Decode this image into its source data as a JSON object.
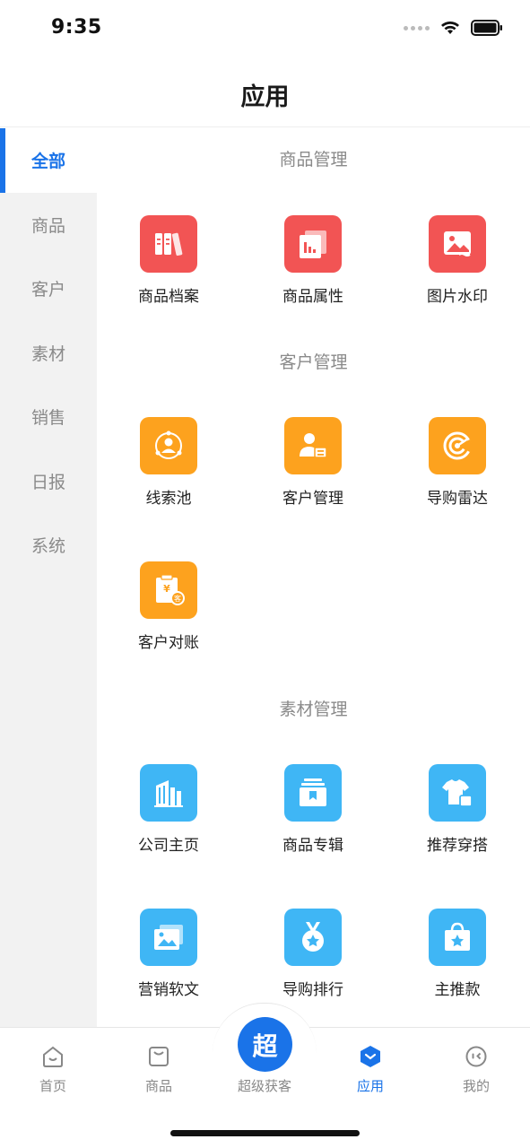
{
  "status": {
    "time": "9:35"
  },
  "header": {
    "title": "应用"
  },
  "sidebar": {
    "items": [
      {
        "label": "全部"
      },
      {
        "label": "商品"
      },
      {
        "label": "客户"
      },
      {
        "label": "素材"
      },
      {
        "label": "销售"
      },
      {
        "label": "日报"
      },
      {
        "label": "系统"
      }
    ],
    "active_index": 0
  },
  "sections": [
    {
      "title": "商品管理",
      "color": "#f25454",
      "tiles": [
        {
          "label": "商品档案",
          "icon": "books-icon"
        },
        {
          "label": "商品属性",
          "icon": "bar-chart-document-icon"
        },
        {
          "label": "图片水印",
          "icon": "image-watermark-icon"
        }
      ]
    },
    {
      "title": "客户管理",
      "color": "#fda21e",
      "tiles": [
        {
          "label": "线索池",
          "icon": "person-network-icon"
        },
        {
          "label": "客户管理",
          "icon": "contact-card-icon"
        },
        {
          "label": "导购雷达",
          "icon": "radar-icon"
        },
        {
          "label": "客户对账",
          "icon": "yuan-clipboard-icon"
        }
      ]
    },
    {
      "title": "素材管理",
      "color": "#3fb6f5",
      "tiles": [
        {
          "label": "公司主页",
          "icon": "building-icon"
        },
        {
          "label": "商品专辑",
          "icon": "album-bookmark-icon"
        },
        {
          "label": "推荐穿搭",
          "icon": "tshirt-bag-icon"
        },
        {
          "label": "营销软文",
          "icon": "photo-stack-icon"
        },
        {
          "label": "导购排行",
          "icon": "medal-star-icon"
        },
        {
          "label": "主推款",
          "icon": "shopping-bag-star-icon"
        }
      ]
    }
  ],
  "tabbar": {
    "tabs": [
      {
        "label": "首页",
        "icon": "home-smile-icon"
      },
      {
        "label": "商品",
        "icon": "product-box-icon"
      },
      {
        "label": "超级获客",
        "icon": "super-icon",
        "glyph": "超"
      },
      {
        "label": "应用",
        "icon": "apps-cube-icon"
      },
      {
        "label": "我的",
        "icon": "profile-face-icon"
      }
    ],
    "active_index": 3
  },
  "colors": {
    "accent": "#1a73e8",
    "inactive": "#888888"
  }
}
